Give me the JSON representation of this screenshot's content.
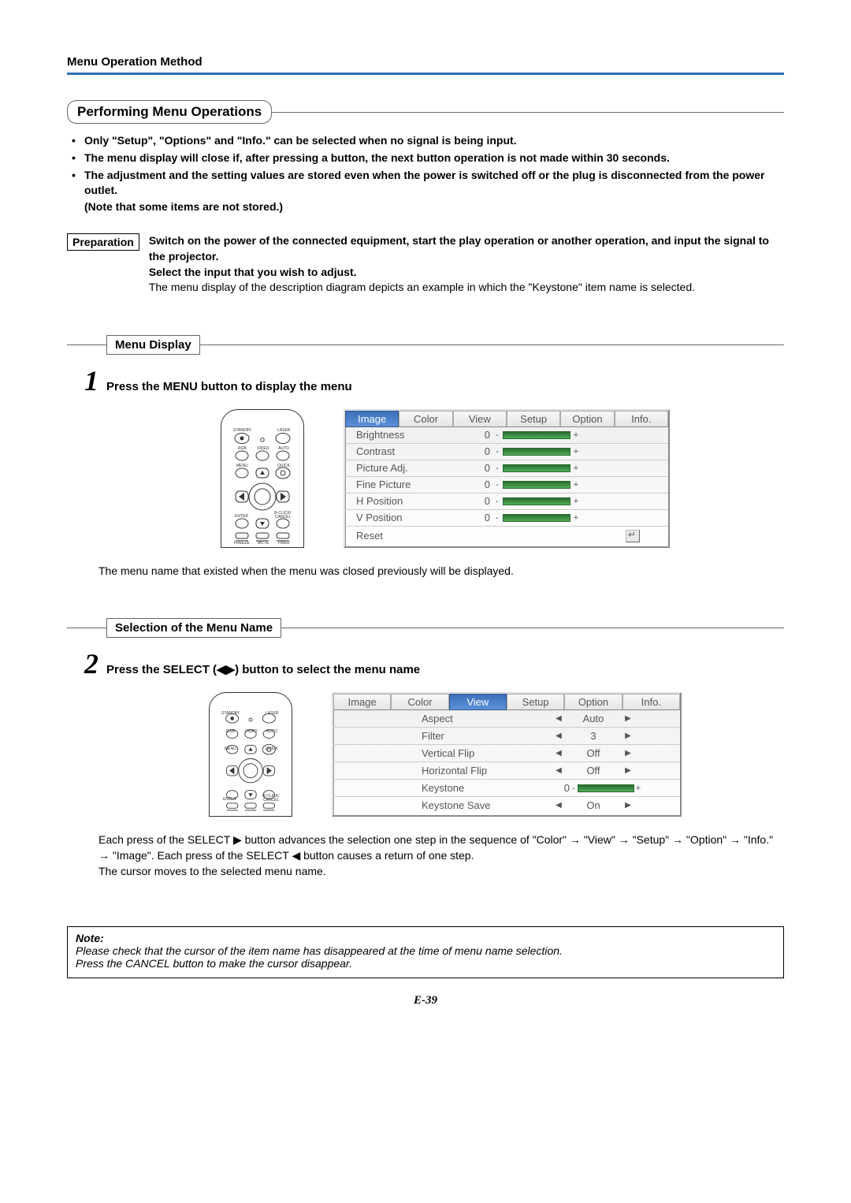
{
  "header": {
    "title": "Menu Operation Method"
  },
  "main_section": {
    "title": "Performing Menu Operations"
  },
  "bullets": [
    "Only \"Setup\", \"Options\" and \"Info.\" can be selected when no signal is being input.",
    "The menu display will close if, after pressing a button, the next button operation is not made within 30 seconds.",
    "The adjustment and the setting values are stored even when the power is switched off or the plug is disconnected from the power outlet."
  ],
  "bullets_note": "(Note that some items are not stored.)",
  "preparation": {
    "label": "Preparation",
    "line1": "Switch on the power of the connected equipment, start the play operation or another operation, and input the signal to the projector.",
    "line2": "Select the input that you wish to adjust.",
    "line3": "The menu display of the description diagram depicts an example in which the \"Keystone\" item name is selected."
  },
  "step1": {
    "sub_title": "Menu Display",
    "num": "1",
    "text": "Press the MENU button to display the menu",
    "osd": {
      "tabs": [
        "Image",
        "Color",
        "View",
        "Setup",
        "Option",
        "Info."
      ],
      "active_tab": 0,
      "rows": [
        {
          "label": "Brightness",
          "val": "0"
        },
        {
          "label": "Contrast",
          "val": "0"
        },
        {
          "label": "Picture Adj.",
          "val": "0"
        },
        {
          "label": "Fine Picture",
          "val": "0"
        },
        {
          "label": "H Position",
          "val": "0"
        },
        {
          "label": "V Position",
          "val": "0"
        }
      ],
      "reset": "Reset"
    },
    "post": "The menu name that existed when the menu was closed previously will be displayed."
  },
  "step2": {
    "sub_title": "Selection of the Menu Name",
    "num": "2",
    "text": "Press the SELECT (◀▶) button to select the menu name",
    "osd": {
      "tabs": [
        "Image",
        "Color",
        "View",
        "Setup",
        "Option",
        "Info."
      ],
      "active_tab": 2,
      "rows": [
        {
          "label": "Aspect",
          "type": "sel",
          "val": "Auto"
        },
        {
          "label": "Filter",
          "type": "sel",
          "val": "3"
        },
        {
          "label": "Vertical Flip",
          "type": "sel",
          "val": "Off"
        },
        {
          "label": "Horizontal Flip",
          "type": "sel",
          "val": "Off"
        },
        {
          "label": "Keystone",
          "type": "bar",
          "val": "0"
        },
        {
          "label": "Keystone Save",
          "type": "sel",
          "val": "On"
        }
      ]
    },
    "post1": "Each press of the SELECT ▶ button advances the selection one step in the sequence of \"Color\" → \"View\" → \"Setup\" → \"Option\"  → \"Info.\" → \"Image\". Each press of the SELECT ◀ button causes a return of one step.",
    "post2": "The cursor moves to the selected menu name."
  },
  "note": {
    "title": "Note:",
    "line1": "Please check that the cursor of the item name has disappeared at the time of menu name selection.",
    "line2": "Press the CANCEL button to make the cursor disappear."
  },
  "page_num": "E-39",
  "remote": {
    "labels": [
      "STANDBY",
      "LASER",
      "RGB",
      "VIDEO",
      "AUTO",
      "MENU",
      "QUICK",
      "ENTER",
      "R-CLICK/",
      "CANCEL",
      "FREEZE",
      "MUTE",
      "TIMER"
    ]
  }
}
